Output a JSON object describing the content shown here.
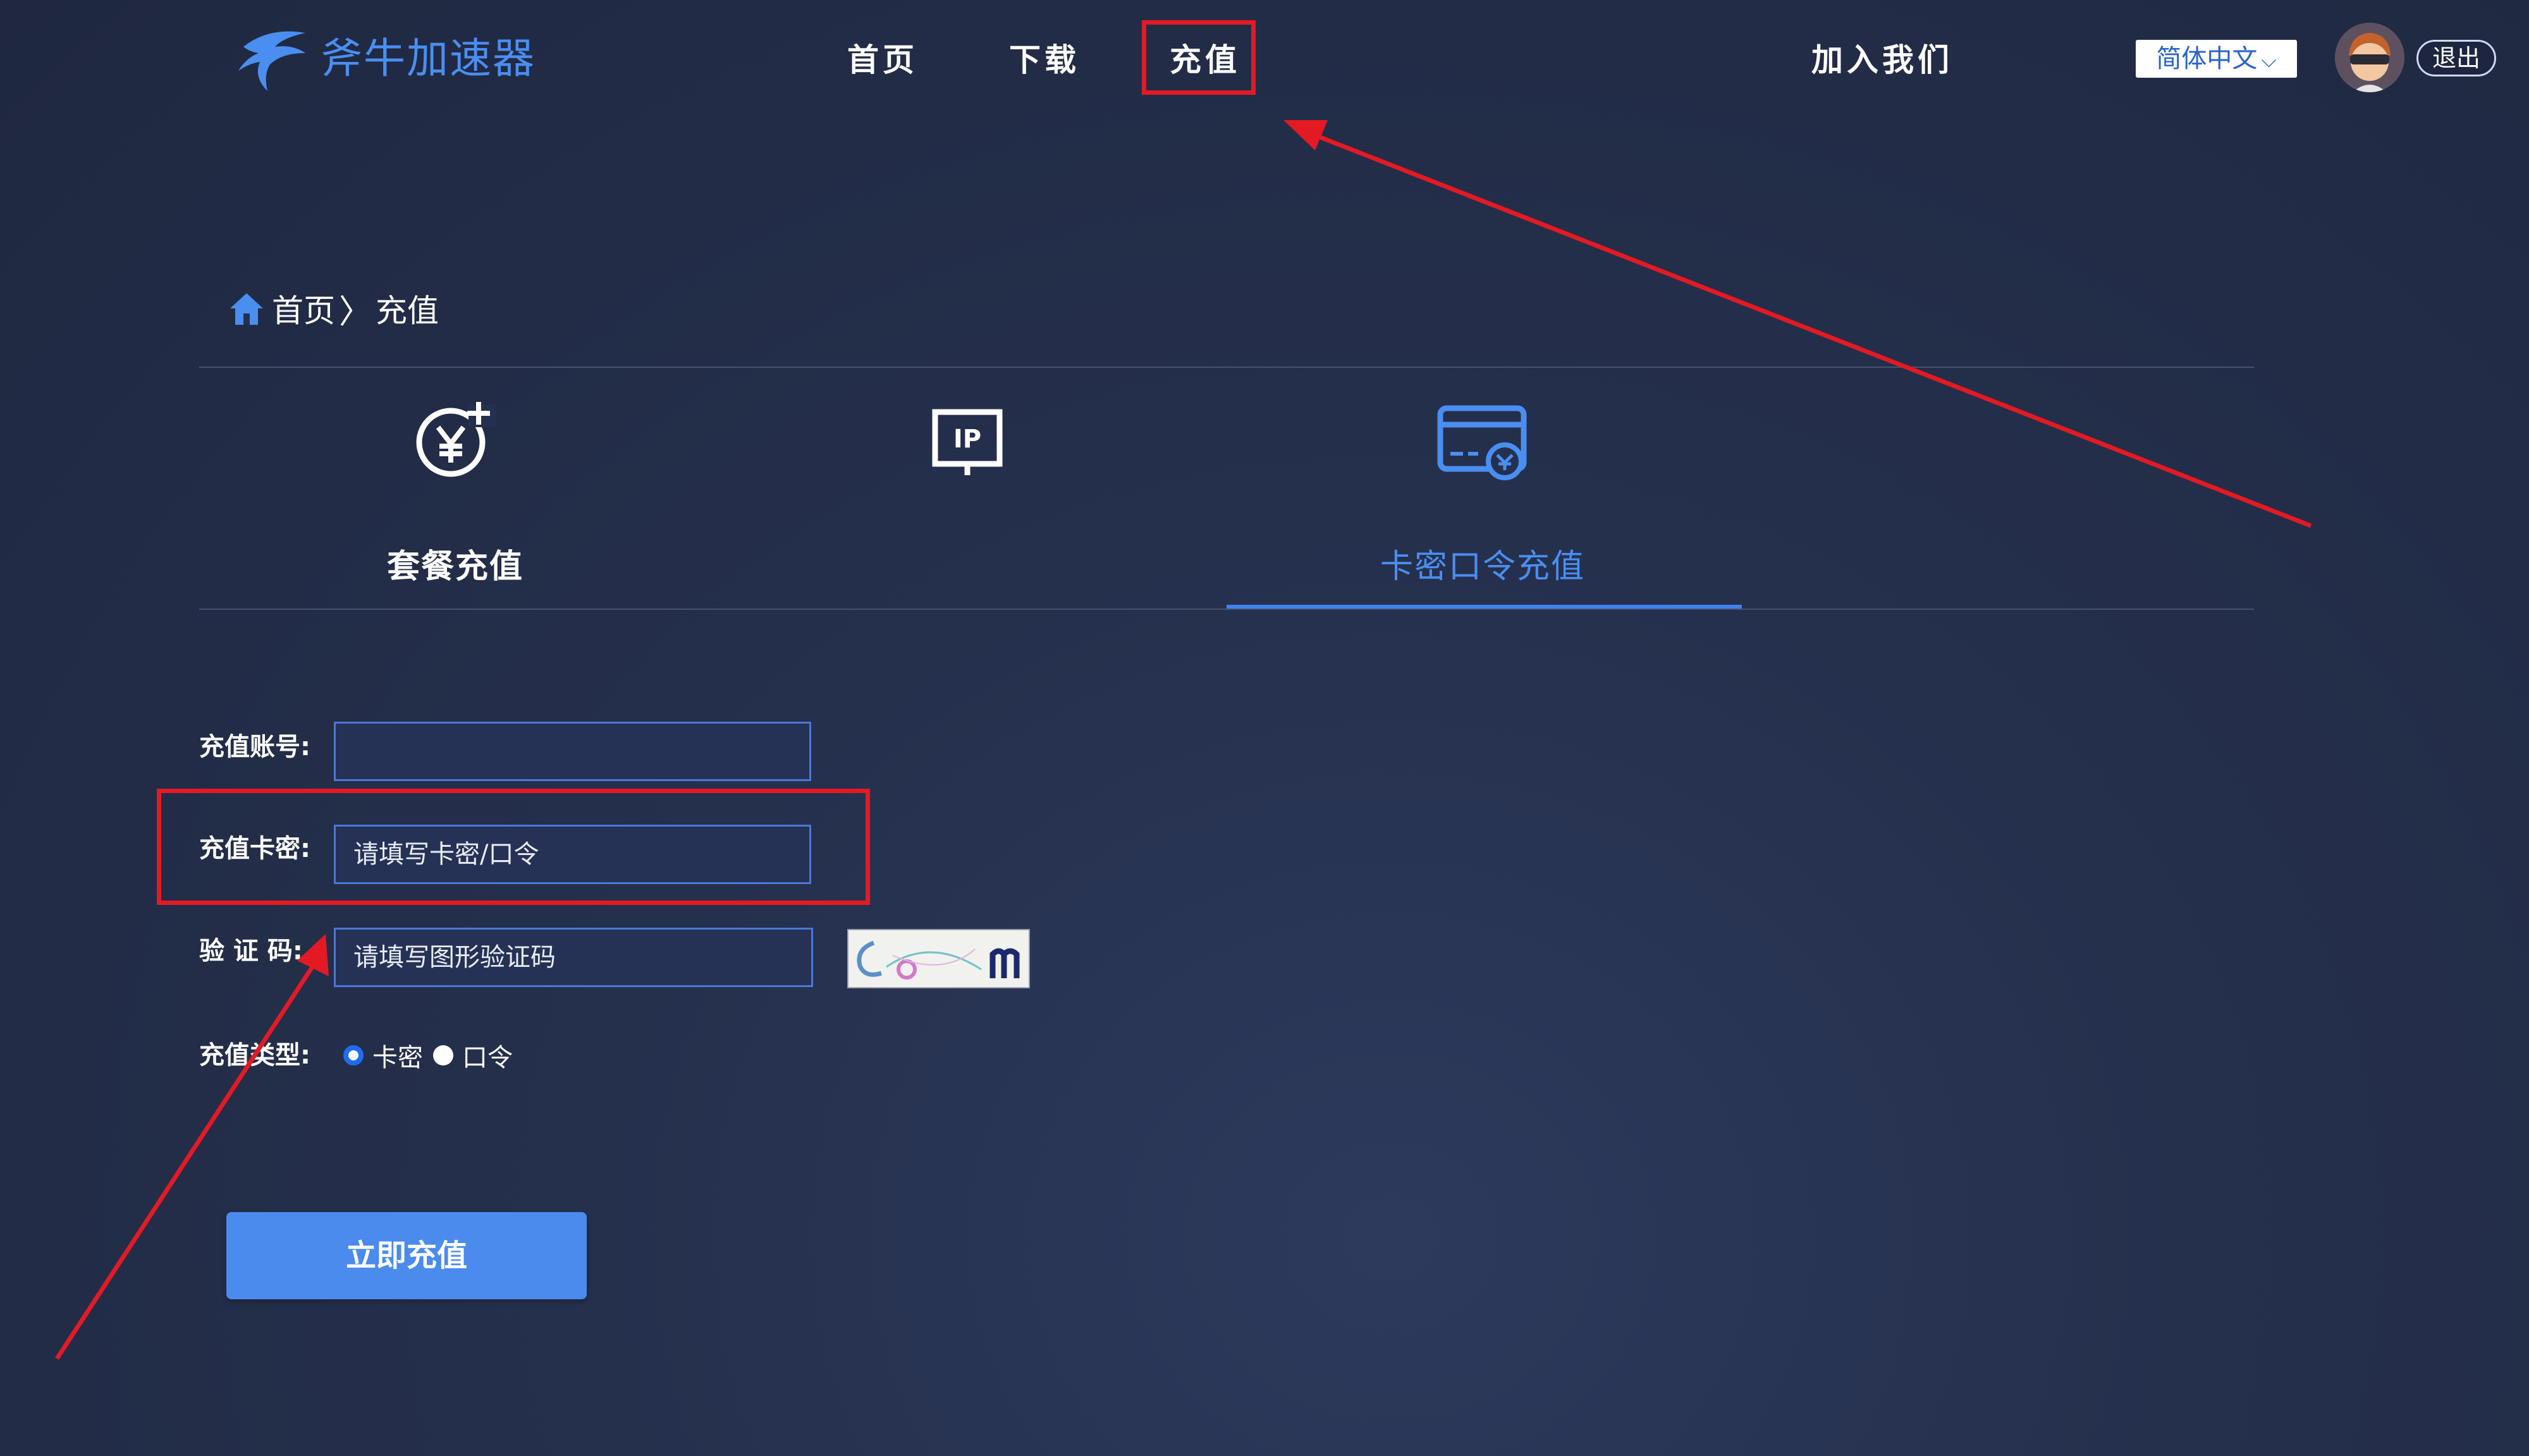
{
  "brand": {
    "name": "斧牛加速器"
  },
  "nav": [
    {
      "label": "首页"
    },
    {
      "label": "下载"
    },
    {
      "label": "充值"
    },
    {
      "label": "加入我们"
    }
  ],
  "language": {
    "selected": "简体中文"
  },
  "user": {
    "logout_label": "退出"
  },
  "breadcrumb": {
    "home": "首页",
    "current": "充值"
  },
  "tabs": [
    {
      "label": "套餐充值",
      "icon": "yuan-coin-icon"
    },
    {
      "label": "",
      "icon": "ip-monitor-icon",
      "icon_text": "IP"
    },
    {
      "label": "卡密口令充值",
      "icon": "card-payment-icon",
      "active": true
    }
  ],
  "form": {
    "account": {
      "label": "充值账号:",
      "value": "",
      "placeholder": ""
    },
    "card": {
      "label": "充值卡密:",
      "placeholder": "请填写卡密/口令"
    },
    "captcha": {
      "label": "验 证 码:",
      "placeholder": "请填写图形验证码"
    },
    "type": {
      "label": "充值类型:",
      "options": [
        {
          "label": "卡密",
          "checked": true
        },
        {
          "label": "口令",
          "checked": false
        }
      ]
    },
    "submit_label": "立即充值"
  },
  "colors": {
    "accent": "#4a8bed",
    "annotation": "#e31a24",
    "background": "#25304d"
  }
}
